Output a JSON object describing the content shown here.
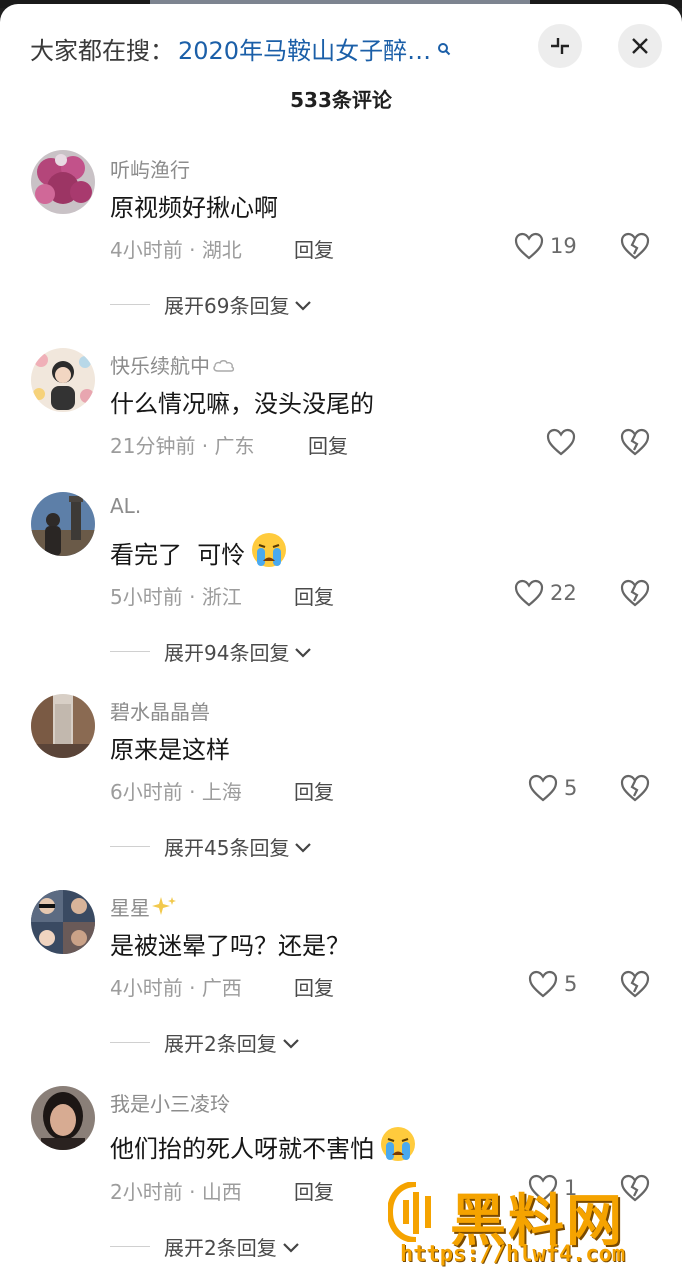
{
  "header": {
    "search_prefix": "大家都在搜：",
    "search_term": "2020年马鞍山女子醉…",
    "comment_count": "533条评论"
  },
  "comments": [
    {
      "user": "听屿渔行",
      "text": "原视频好揪心啊",
      "time": "4小时前",
      "region": "湖北",
      "reply": "回复",
      "likes": "19",
      "expand": "展开69条回复",
      "emoji": ""
    },
    {
      "user": "快乐续航中",
      "text": "什么情况嘛，没头没尾的",
      "time": "21分钟前",
      "region": "广东",
      "reply": "回复",
      "likes": "",
      "expand": "",
      "emoji": ""
    },
    {
      "user": "AL.",
      "text": "看完了  可怜",
      "time": "5小时前",
      "region": "浙江",
      "reply": "回复",
      "likes": "22",
      "expand": "展开94条回复",
      "emoji": "crying-emoji"
    },
    {
      "user": "碧水晶晶兽",
      "text": "原来是这样",
      "time": "6小时前",
      "region": "上海",
      "reply": "回复",
      "likes": "5",
      "expand": "展开45条回复",
      "emoji": ""
    },
    {
      "user": "星星",
      "text": "是被迷晕了吗？还是？",
      "time": "4小时前",
      "region": "广西",
      "reply": "回复",
      "likes": "5",
      "expand": "展开2条回复",
      "emoji": ""
    },
    {
      "user": "我是小三凌玲",
      "text": "他们抬的死人呀就不害怕",
      "time": "2小时前",
      "region": "山西",
      "reply": "回复",
      "likes": "1",
      "expand": "展开2条回复",
      "emoji": "crying-emoji"
    }
  ],
  "watermark": {
    "brand": "黑料网",
    "url": "https://hlwf4.com"
  },
  "colors": {
    "search_term": "#1b5fa8",
    "watermark": "#f5a300"
  }
}
